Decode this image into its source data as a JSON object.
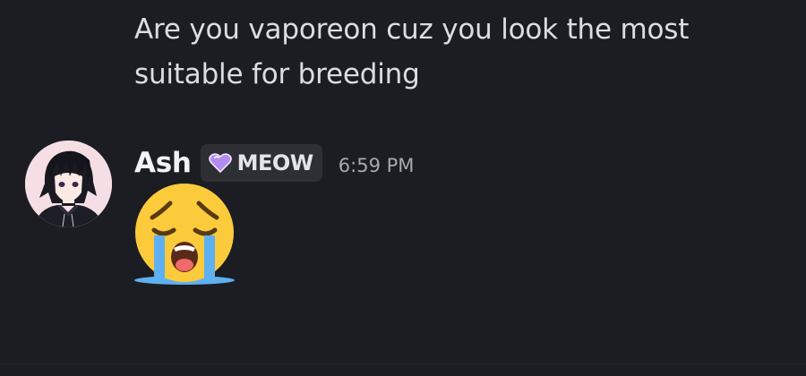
{
  "previous_message": {
    "text": "Are you vaporeon cuz you look the most suitable for breeding"
  },
  "message": {
    "author": "Ash",
    "tag": {
      "icon": "purple-heart-icon",
      "label": "MEOW"
    },
    "timestamp": "6:59 PM",
    "content_emoji": "loudly-crying-face-emoji"
  },
  "colors": {
    "background": "#1c1d22",
    "tag_background": "#2e2f35",
    "username": "#f2f3f5",
    "timestamp": "#a6a9b0",
    "heart": "#b38cf0"
  }
}
